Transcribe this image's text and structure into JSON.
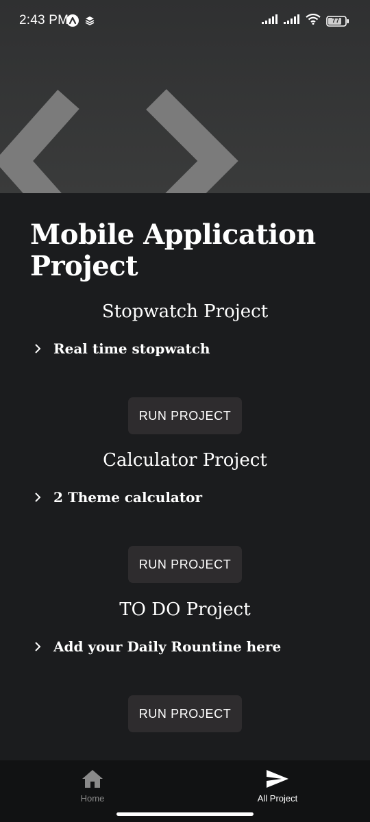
{
  "status_bar": {
    "time": "2:43 PM",
    "battery": "77",
    "icons_left": [
      "app-notification-icon",
      "layers-icon"
    ],
    "icons_right": [
      "signal-icon",
      "signal-icon",
      "wifi-icon",
      "battery-icon"
    ]
  },
  "hero": {
    "icon": "code-brackets-icon",
    "colors": {
      "background": "#353636",
      "brackets": "#7b7b7b"
    }
  },
  "page": {
    "title": "Mobile Application Project"
  },
  "projects": [
    {
      "title": "Stopwatch Project",
      "feature": "Real time stopwatch",
      "button_label": "RUN PROJECT"
    },
    {
      "title": "Calculator Project",
      "feature": "2 Theme calculator",
      "button_label": "RUN PROJECT"
    },
    {
      "title": "TO DO Project",
      "feature": "Add your Daily Rountine here",
      "button_label": "RUN PROJECT"
    }
  ],
  "bottom_nav": {
    "items": [
      {
        "label": "Home",
        "icon": "home-icon",
        "active": false
      },
      {
        "label": "All Project",
        "icon": "send-icon",
        "active": true
      }
    ]
  },
  "colors": {
    "background": "#1b1c1e",
    "button": "#2e2c2e",
    "nav_background": "#111213",
    "text": "#ffffff",
    "inactive_text": "#8a8a8a"
  }
}
